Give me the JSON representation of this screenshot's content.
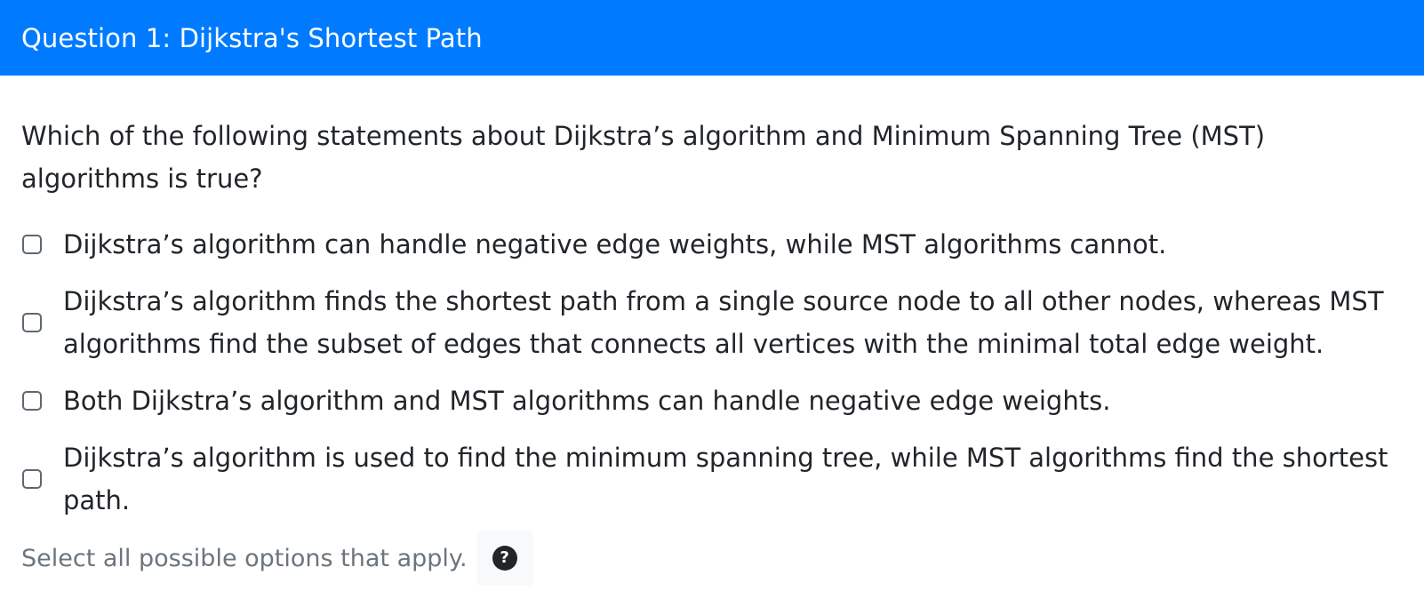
{
  "header": {
    "title": "Question 1: Dijkstra's Shortest Path"
  },
  "question": {
    "prompt": "Which of the following statements about Dijkstra’s algorithm and Minimum Spanning Tree (MST) algorithms is true?",
    "options": [
      {
        "label": "Dijkstra’s algorithm can handle negative edge weights, while MST algorithms cannot.",
        "checked": false
      },
      {
        "label": "Dijkstra’s algorithm finds the shortest path from a single source node to all other nodes, whereas MST algorithms find the subset of edges that connects all vertices with the minimal total edge weight.",
        "checked": false
      },
      {
        "label": "Both Dijkstra’s algorithm and MST algorithms can handle negative edge weights.",
        "checked": false
      },
      {
        "label": "Dijkstra’s algorithm is used to find the minimum spanning tree, while MST algorithms find the shortest path.",
        "checked": false
      }
    ],
    "help_text": "Select all possible options that apply.",
    "help_icon": "question-circle-icon"
  },
  "colors": {
    "header_bg": "#007bff",
    "header_text": "#ffffff",
    "body_text": "#212529",
    "muted_text": "#6c757d"
  }
}
